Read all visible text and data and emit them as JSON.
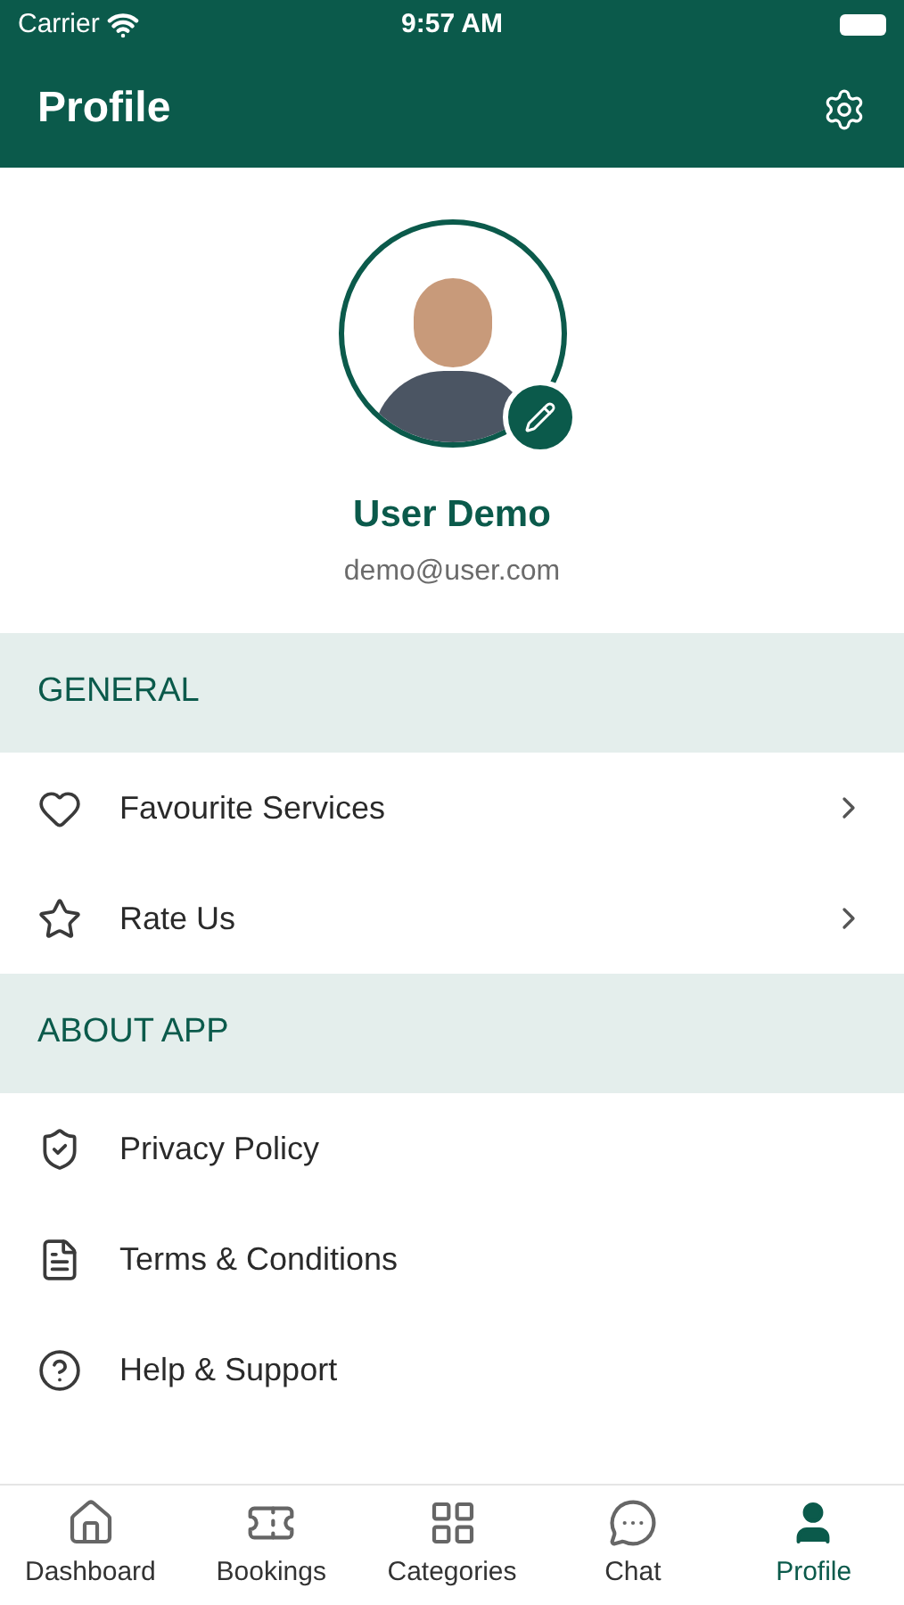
{
  "status_bar": {
    "carrier": "Carrier",
    "time": "9:57 AM"
  },
  "header": {
    "title": "Profile"
  },
  "profile": {
    "name": "User Demo",
    "email": "demo@user.com"
  },
  "sections": [
    {
      "title": "GENERAL",
      "items": [
        {
          "label": "Favourite Services",
          "kind": "link"
        },
        {
          "label": "Rate Us",
          "kind": "link"
        }
      ]
    },
    {
      "title": "ABOUT APP",
      "items": [
        {
          "label": "Privacy Policy",
          "kind": "plain"
        },
        {
          "label": "Terms & Conditions",
          "kind": "plain"
        },
        {
          "label": "Help & Support",
          "kind": "plain"
        }
      ]
    }
  ],
  "tabs": [
    {
      "label": "Dashboard",
      "selected": false
    },
    {
      "label": "Bookings",
      "selected": false
    },
    {
      "label": "Categories",
      "selected": false
    },
    {
      "label": "Chat",
      "selected": false
    },
    {
      "label": "Profile",
      "selected": true
    }
  ]
}
